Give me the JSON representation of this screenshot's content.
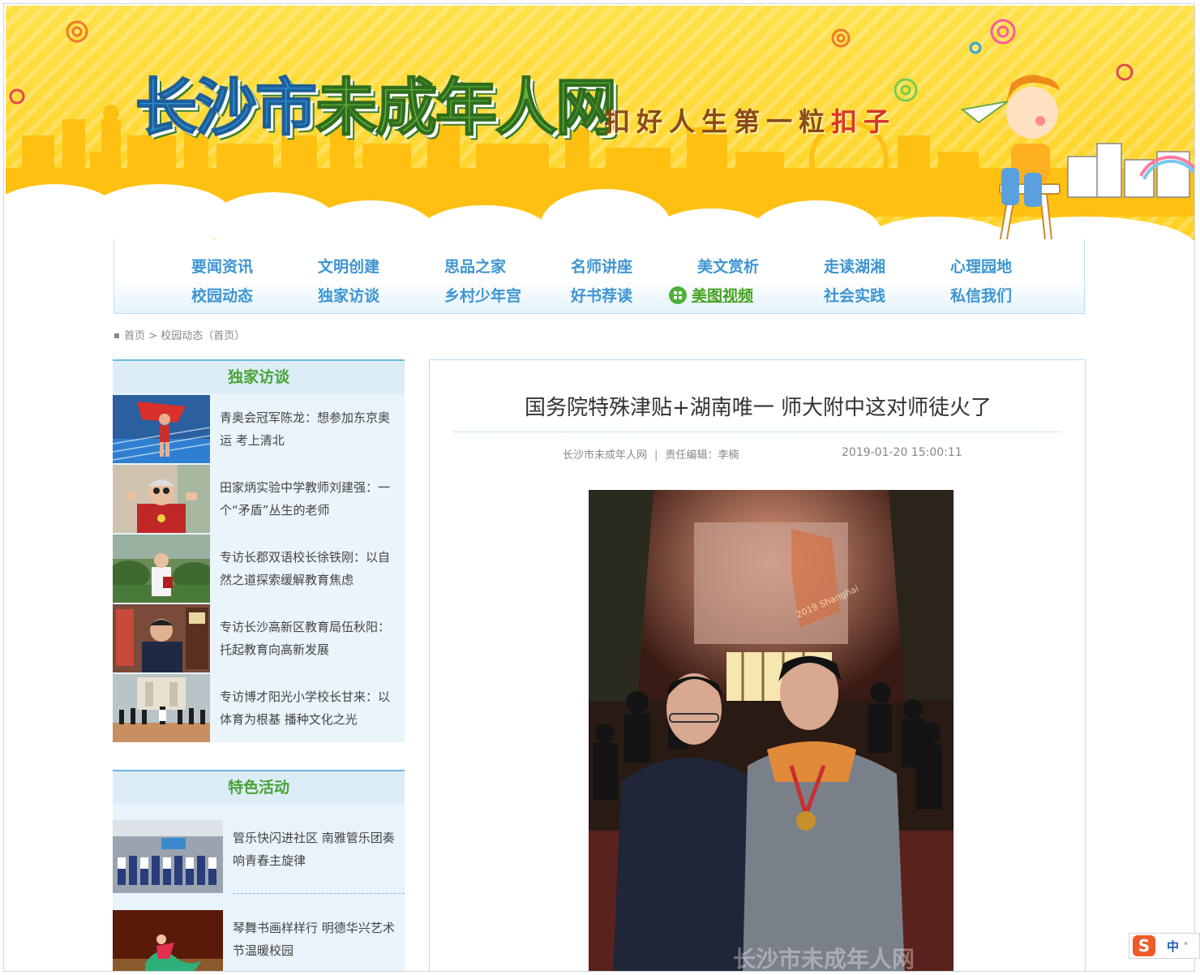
{
  "site": {
    "title_part1": "长沙市",
    "title_part2": "未成年人网",
    "slogan_part1": "扣好人生第一粒",
    "slogan_part2": "扣子"
  },
  "nav": {
    "row1": [
      "要闻资讯",
      "文明创建",
      "思品之家",
      "名师讲座",
      "美文赏析",
      "走读湖湘",
      "心理园地"
    ],
    "row2": [
      "校园动态",
      "独家访谈",
      "乡村少年宫",
      "好书荐读",
      "美图视频",
      "社会实践",
      "私信我们"
    ],
    "active": "美图视频"
  },
  "breadcrumb": {
    "home": "首页",
    "sep": ">",
    "current": "校园动态（首页）"
  },
  "exclusive": {
    "heading": "独家访谈",
    "items": [
      {
        "text": "青奥会冠军陈龙：想参加东京奥运 考上清北"
      },
      {
        "text": "田家炳实验中学教师刘建强：一个“矛盾”丛生的老师"
      },
      {
        "text": "专访长郡双语校长徐铁刚：以自然之道探索缓解教育焦虑"
      },
      {
        "text": "专访长沙高新区教育局伍秋阳：托起教育向高新发展"
      },
      {
        "text": "专访博才阳光小学校长甘来：以体育为根基 播种文化之光"
      }
    ]
  },
  "featured": {
    "heading": "特色活动",
    "items": [
      {
        "text": "管乐快闪进社区 南雅管乐团奏响青春主旋律"
      },
      {
        "text": "琴舞书画样样行 明德华兴艺术节温暖校园"
      }
    ]
  },
  "article": {
    "title": "国务院特殊津贴+湖南唯一 师大附中这对师徒火了",
    "source": "长沙市未成年人网",
    "divider": "|",
    "editor": "责任编辑：李楠",
    "date": "2019-01-20 15:00:11",
    "photo_watermark": "长沙市未成年人网",
    "photo_sign": "2019 Shanghai"
  },
  "ime": {
    "logo": "S",
    "mode": "中",
    "dot": "°"
  },
  "colors": {
    "nav_blue": "#3d95d3",
    "green": "#4aa335",
    "panel_bg": "#e8f3fb",
    "banner_yellow": "#ffd42a"
  }
}
